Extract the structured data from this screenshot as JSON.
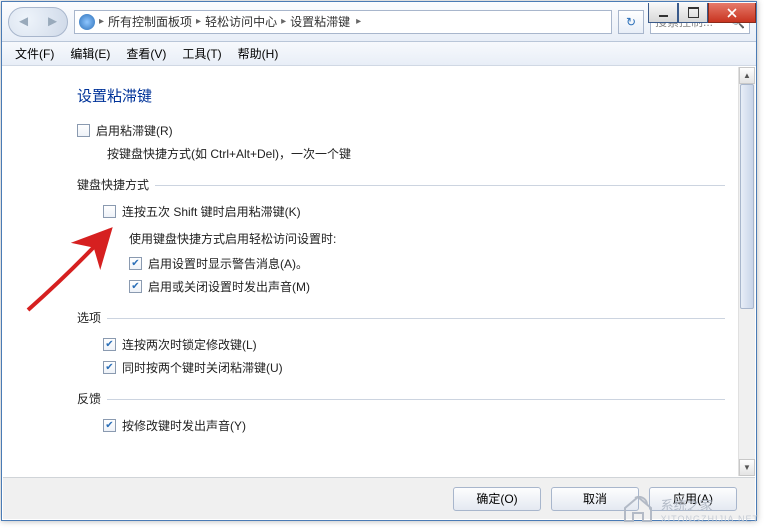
{
  "titlebar": {
    "min": "",
    "max": "",
    "close": ""
  },
  "nav": {
    "crumb_allcp": "所有控制面板项",
    "crumb_ease": "轻松访问中心",
    "crumb_sticky": "设置粘滞键",
    "search_placeholder": "搜索控制...",
    "refresh_symbol": "↻"
  },
  "menu": {
    "file": "文件(F)",
    "edit": "编辑(E)",
    "view": "查看(V)",
    "tools": "工具(T)",
    "help": "帮助(H)"
  },
  "page": {
    "title": "设置粘滞键",
    "enable_label": "启用粘滞键(R)",
    "enable_help": "按键盘快捷方式(如 Ctrl+Alt+Del)，一次一个键",
    "group_shortcut": "键盘快捷方式",
    "shift5": "连按五次 Shift 键时启用粘滞键(K)",
    "sub_intro": "使用键盘快捷方式启用轻松访问设置时:",
    "warn": "启用设置时显示警告消息(A)。",
    "sound_toggle": "启用或关闭设置时发出声音(M)",
    "group_options": "选项",
    "lock": "连按两次时锁定修改键(L)",
    "twokeys": "同时按两个键时关闭粘滞键(U)",
    "group_feedback": "反馈",
    "mod_sound": "按修改键时发出声音(Y)"
  },
  "buttons": {
    "ok": "确定(O)",
    "cancel": "取消",
    "apply": "应用(A)"
  },
  "watermark": {
    "brand": "系统之家",
    "sub": "XITONGZHIJIA.NET"
  }
}
